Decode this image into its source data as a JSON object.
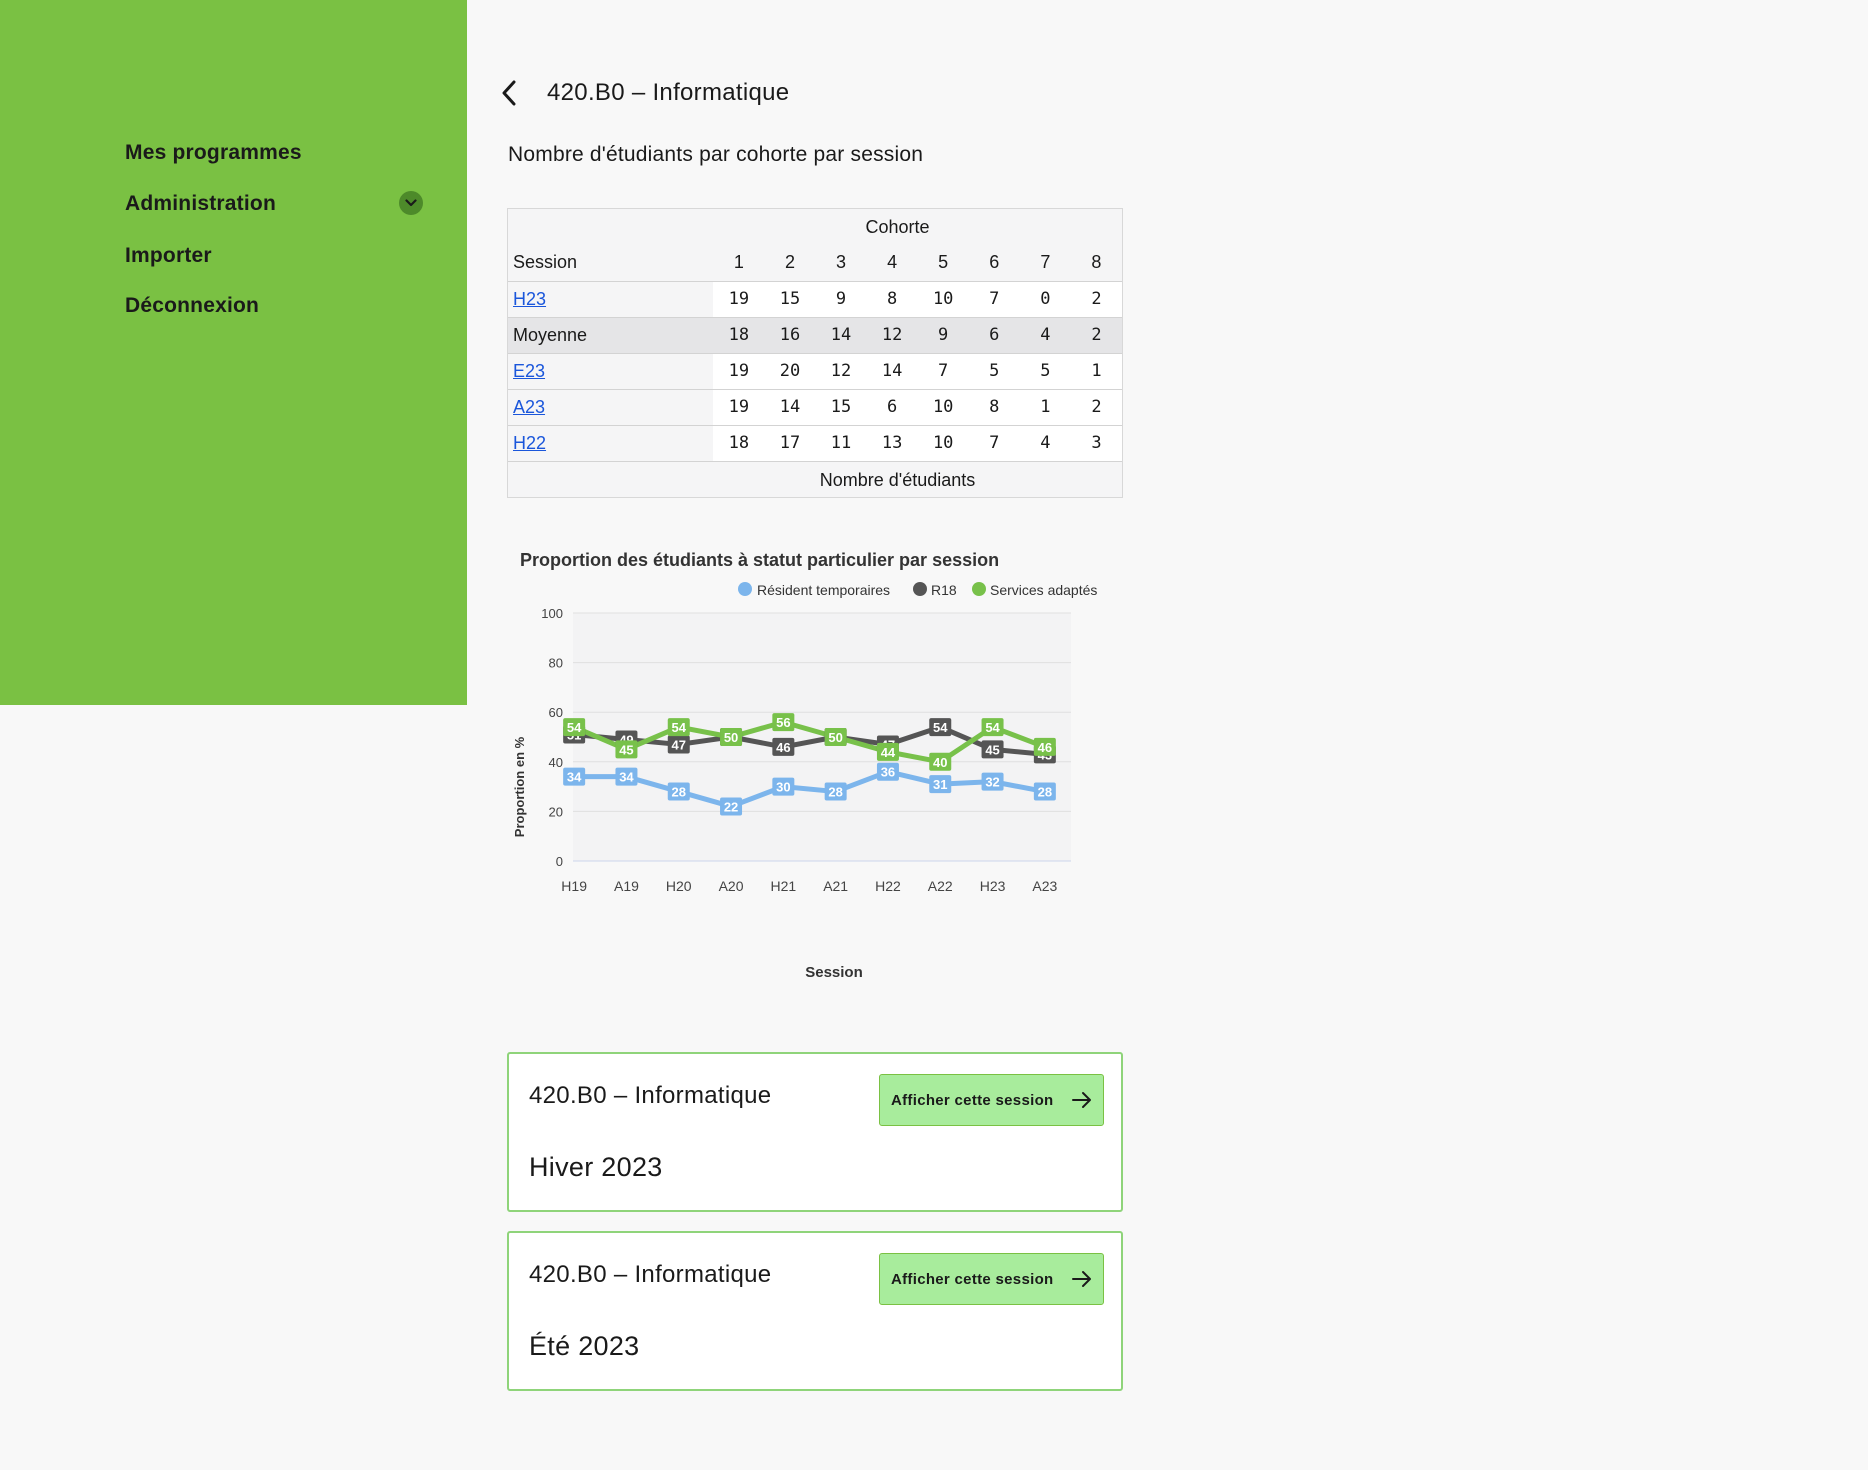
{
  "sidebar": {
    "items": [
      {
        "label": "Mes programmes"
      },
      {
        "label": "Administration"
      },
      {
        "label": "Importer"
      },
      {
        "label": "Déconnexion"
      }
    ]
  },
  "header": {
    "title": "420.B0 – Informatique"
  },
  "table": {
    "title": "Nombre d'étudiants par cohorte par session",
    "group_header": "Cohorte",
    "session_header": "Session",
    "cohorts": [
      "1",
      "2",
      "3",
      "4",
      "5",
      "6",
      "7",
      "8"
    ],
    "rows": [
      {
        "session": "H23",
        "link": true,
        "values": [
          19,
          15,
          9,
          8,
          10,
          7,
          0,
          2
        ]
      },
      {
        "session": "Moyenne",
        "link": false,
        "values": [
          18,
          16,
          14,
          12,
          9,
          6,
          4,
          2
        ]
      },
      {
        "session": "E23",
        "link": true,
        "values": [
          19,
          20,
          12,
          14,
          7,
          5,
          5,
          1
        ]
      },
      {
        "session": "A23",
        "link": true,
        "values": [
          19,
          14,
          15,
          6,
          10,
          8,
          1,
          2
        ]
      },
      {
        "session": "H22",
        "link": true,
        "values": [
          18,
          17,
          11,
          13,
          10,
          7,
          4,
          3
        ]
      }
    ],
    "footer": "Nombre d'étudiants"
  },
  "chart_data": {
    "type": "line",
    "title": "Proportion des étudiants à statut particulier par session",
    "xlabel": "Session",
    "ylabel": "Proportion en %",
    "categories": [
      "H19",
      "A19",
      "H20",
      "A20",
      "H21",
      "A21",
      "H22",
      "A22",
      "H23",
      "A23"
    ],
    "ylim": [
      0,
      100
    ],
    "yticks": [
      0,
      20,
      40,
      60,
      80,
      100
    ],
    "legend_position": "top-right",
    "series": [
      {
        "name": "Résident temporaires",
        "color": "#7cb5ec",
        "values": [
          34,
          34,
          28,
          22,
          30,
          28,
          36,
          31,
          32,
          28
        ]
      },
      {
        "name": "R18",
        "color": "#555555",
        "values": [
          51,
          49,
          47,
          50,
          46,
          50,
          47,
          54,
          45,
          43
        ]
      },
      {
        "name": "Services adaptés",
        "color": "#78c14a",
        "values": [
          54,
          45,
          54,
          50,
          56,
          50,
          44,
          40,
          54,
          46
        ]
      }
    ]
  },
  "cards": [
    {
      "title": "420.B0 – Informatique",
      "subtitle": "Hiver 2023",
      "button": "Afficher cette session"
    },
    {
      "title": "420.B0 – Informatique",
      "subtitle": "Été 2023",
      "button": "Afficher cette session"
    }
  ],
  "colors": {
    "sidebar": "#7ac143",
    "button": "#a8ec9c",
    "card_border": "#8fd47a",
    "link": "#1a56db"
  }
}
